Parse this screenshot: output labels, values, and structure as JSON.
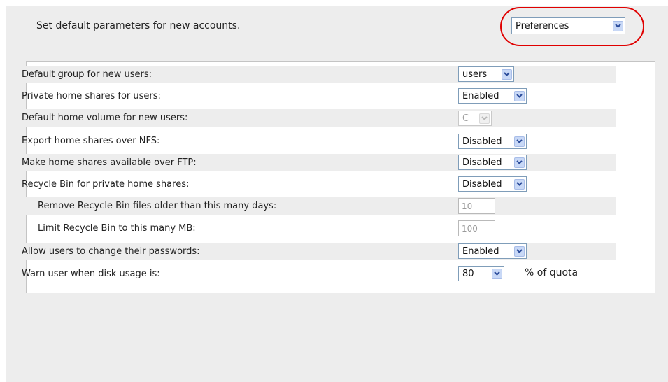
{
  "header": {
    "description": "Set default parameters for new accounts.",
    "view_select": {
      "value": "Preferences"
    }
  },
  "form": {
    "rows": [
      {
        "label": "Default group for new users:",
        "value": "users"
      },
      {
        "label": "Private home shares for users:",
        "value": "Enabled"
      },
      {
        "label": "Default home volume for new users:",
        "value": "C"
      },
      {
        "label": "Export home shares over NFS:",
        "value": "Disabled"
      },
      {
        "label": "Make home shares available over FTP:",
        "value": "Disabled"
      },
      {
        "label": "Recycle Bin for private home shares:",
        "value": "Disabled"
      },
      {
        "label": "Remove Recycle Bin files older than this many days:",
        "value": "10"
      },
      {
        "label": "Limit Recycle Bin to this many MB:",
        "value": "100"
      },
      {
        "label": "Allow users to change their passwords:",
        "value": "Enabled"
      },
      {
        "label": "Warn user when disk usage is:",
        "value": "80",
        "suffix": "% of quota"
      }
    ]
  },
  "colors": {
    "annotation_ring": "#e00000",
    "row_shade": "#ededed",
    "select_border": "#7f9db9",
    "dropdown_button": "#c8d8f6"
  },
  "icons": {
    "dropdown": "chevron-down-icon"
  }
}
